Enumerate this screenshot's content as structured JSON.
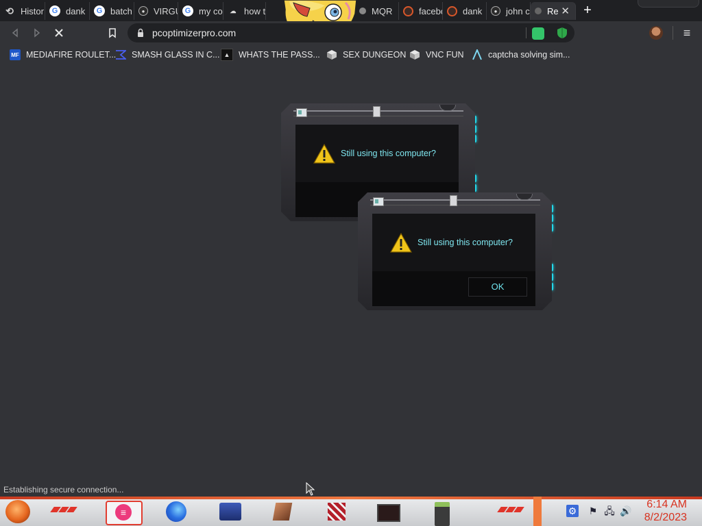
{
  "browser": {
    "tabs": [
      {
        "title": "Histor",
        "icon": "history-icon"
      },
      {
        "title": "dank",
        "icon": "google-icon"
      },
      {
        "title": "batch",
        "icon": "google-icon"
      },
      {
        "title": "VIRGU",
        "icon": "github-icon"
      },
      {
        "title": "my co",
        "icon": "google-icon"
      },
      {
        "title": "how t",
        "icon": "site-icon"
      },
      {
        "title": "MQR",
        "icon": "site-icon"
      },
      {
        "title": "facebo",
        "icon": "spiral-icon"
      },
      {
        "title": "dank",
        "icon": "spiral-icon"
      },
      {
        "title": "john c",
        "icon": "github-icon"
      },
      {
        "title": "Re",
        "icon": "site-icon",
        "active": true
      }
    ],
    "new_tab_label": "+",
    "close_tab_label": "✕",
    "url": "pcoptimizerpro.com",
    "bookmarks": [
      {
        "label": "MEDIAFIRE ROULET...",
        "icon": "mediafire-icon"
      },
      {
        "label": "SMASH GLASS IN C...",
        "icon": "smash-icon"
      },
      {
        "label": "WHATS THE PASS...",
        "icon": "password-icon"
      },
      {
        "label": "SEX DUNGEON",
        "icon": "cube-icon"
      },
      {
        "label": "VNC FUN",
        "icon": "cube-icon"
      },
      {
        "label": "captcha solving sim...",
        "icon": "caret-icon"
      }
    ],
    "status_text": "Establishing secure connection..."
  },
  "dialogs": [
    {
      "message": "Still using this computer?",
      "has_ok": false
    },
    {
      "message": "Still using this computer?",
      "has_ok": true,
      "ok_label": "OK"
    }
  ],
  "taskbar": {
    "time": "6:14 AM",
    "date": "8/2/2023",
    "apps": [
      "start-orb",
      "notes-app",
      "firefox",
      "media-player",
      "book-app",
      "rubiks-app",
      "film-app",
      "calculator-app"
    ]
  },
  "colors": {
    "accent_cyan": "#22d9ea",
    "dialog_text": "#7fe6ef",
    "clock_red": "#d8321f",
    "taskbar_red": "#e0342a"
  }
}
